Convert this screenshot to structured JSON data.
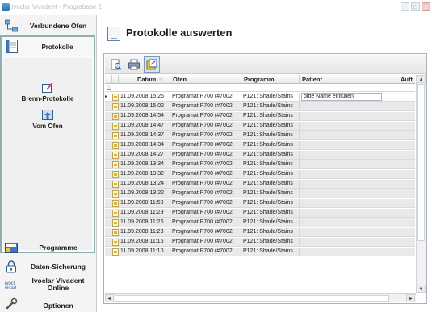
{
  "window": {
    "title": "Ivoclar Vivadent - Prograbase 2",
    "buttons": {
      "minimize": "_",
      "maximize": "□",
      "close": "x"
    }
  },
  "sidebar": {
    "top_item": {
      "label": "Verbundene Öfen",
      "icon": "connected-furnaces-icon"
    },
    "active_panel": {
      "label": "Protokolle",
      "icon": "protocols-icon",
      "subitems": [
        {
          "label": "Brenn-Protokolle",
          "icon": "firing-protocol-icon"
        },
        {
          "label": "Vom Ofen",
          "icon": "from-furnace-icon"
        }
      ]
    },
    "bottom_items": [
      {
        "label": "Programme",
        "icon": "programs-icon"
      },
      {
        "label": "Daten-Sicherung",
        "icon": "lock-icon"
      },
      {
        "label": "Ivoclar Vivadent Online",
        "icon": "ivoclar-vivadent-logo-icon"
      },
      {
        "label": "Optionen",
        "icon": "wrench-icon"
      }
    ]
  },
  "page": {
    "title": "Protokolle auswerten",
    "icon": "document-icon"
  },
  "toolbar": {
    "buttons": [
      {
        "name": "preview",
        "icon": "print-preview-icon"
      },
      {
        "name": "print",
        "icon": "printer-icon"
      },
      {
        "name": "export",
        "icon": "export-icon"
      }
    ]
  },
  "table": {
    "columns": [
      "Datum",
      "Ofen",
      "Programm",
      "Patient",
      "Auft"
    ],
    "patient_placeholder": "bitte Name einfüllen",
    "rows": [
      {
        "datum": "11.09.2008 15:25",
        "ofen": "Programat P700 (#7002",
        "programm": "P121: Shade/Stains",
        "patient": "bitte Name einfüllen"
      },
      {
        "datum": "11.09.2008 15:02",
        "ofen": "Programat P700 (#7002",
        "programm": "P121: Shade/Stains",
        "patient": ""
      },
      {
        "datum": "11.09.2008 14:54",
        "ofen": "Programat P700 (#7002",
        "programm": "P121: Shade/Stains",
        "patient": ""
      },
      {
        "datum": "11.09.2008 14:47",
        "ofen": "Programat P700 (#7002",
        "programm": "P121: Shade/Stains",
        "patient": ""
      },
      {
        "datum": "11.09.2008 14:37",
        "ofen": "Programat P700 (#7002",
        "programm": "P121: Shade/Stains",
        "patient": ""
      },
      {
        "datum": "11.09.2008 14:34",
        "ofen": "Programat P700 (#7002",
        "programm": "P121: Shade/Stains",
        "patient": ""
      },
      {
        "datum": "11.09.2008 14:27",
        "ofen": "Programat P700 (#7002",
        "programm": "P121: Shade/Stains",
        "patient": ""
      },
      {
        "datum": "11.09.2008 13:34",
        "ofen": "Programat P700 (#7002",
        "programm": "P121: Shade/Stains",
        "patient": ""
      },
      {
        "datum": "11.09.2008 13:32",
        "ofen": "Programat P700 (#7002",
        "programm": "P121: Shade/Stains",
        "patient": ""
      },
      {
        "datum": "11.09.2008 13:24",
        "ofen": "Programat P700 (#7002",
        "programm": "P121: Shade/Stains",
        "patient": ""
      },
      {
        "datum": "11.09.2008 13:22",
        "ofen": "Programat P700 (#7002",
        "programm": "P121: Shade/Stains",
        "patient": ""
      },
      {
        "datum": "11.09.2008 11:50",
        "ofen": "Programat P700 (#7002",
        "programm": "P121: Shade/Stains",
        "patient": ""
      },
      {
        "datum": "11.09.2008 11:29",
        "ofen": "Programat P700 (#7002",
        "programm": "P121: Shade/Stains",
        "patient": ""
      },
      {
        "datum": "11.09.2008 11:26",
        "ofen": "Programat P700 (#7002",
        "programm": "P121: Shade/Stains",
        "patient": ""
      },
      {
        "datum": "11.09.2008 11:23",
        "ofen": "Programat P700 (#7002",
        "programm": "P121: Shade/Stains",
        "patient": ""
      },
      {
        "datum": "11.09.2008 11:16",
        "ofen": "Programat P700 (#7002",
        "programm": "P121: Shade/Stains",
        "patient": ""
      },
      {
        "datum": "11.09.2008 11:10",
        "ofen": "Programat P700 (#7002",
        "programm": "P121: Shade/Stains",
        "patient": ""
      }
    ]
  },
  "colors": {
    "panel_border": "#8fb0ae",
    "row_background": "#e9e9e9",
    "selected_row": "#ffffff",
    "header_text": "#1a1a1a"
  }
}
